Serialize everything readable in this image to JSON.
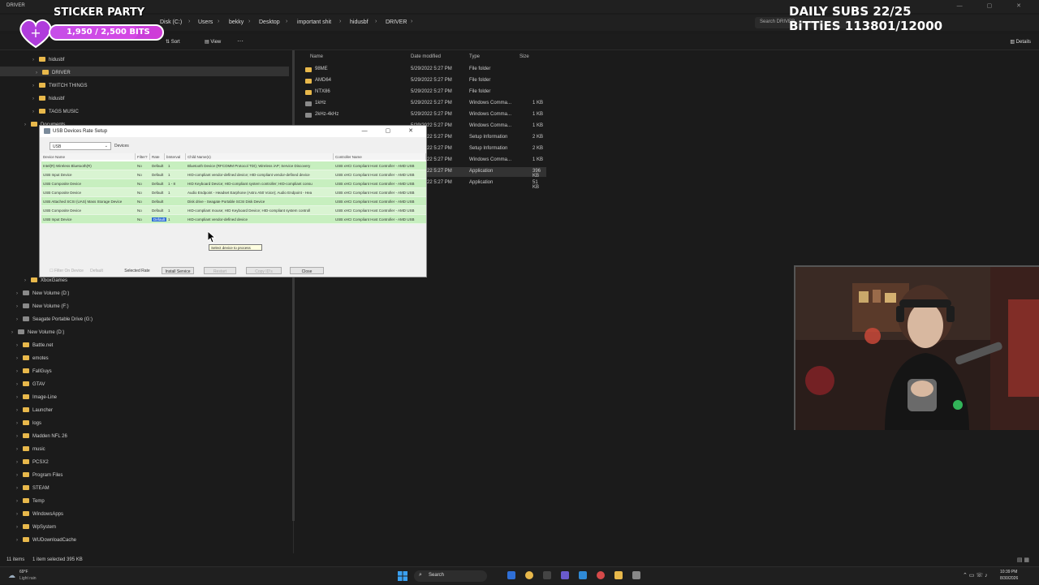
{
  "window": {
    "title": "DRIVER",
    "controls": "—  ▢  ✕"
  },
  "address": {
    "crumbs": [
      "Disk (C:)",
      "Users",
      "bekky",
      "Desktop",
      "important shit",
      "hidusbf",
      "DRIVER"
    ],
    "search_placeholder": "Search DRIVER"
  },
  "toolbar": {
    "sort_label": "Sort",
    "view_label": "View",
    "more_label": "···",
    "details_label": "Details"
  },
  "nav": {
    "items": [
      {
        "label": "hidusbf",
        "type": "folder"
      },
      {
        "label": "DRIVER",
        "type": "folder"
      },
      {
        "label": "TWITCH THINGS",
        "type": "folder"
      },
      {
        "label": "hidusbf",
        "type": "folder"
      },
      {
        "label": "TAGS MUSIC",
        "type": "folder"
      },
      {
        "label": "Documents",
        "type": "folder"
      },
      {
        "label": "XboxGames",
        "type": "folder"
      },
      {
        "label": "New Volume (D:)",
        "type": "drive"
      },
      {
        "label": "New Volume (F:)",
        "type": "drive"
      },
      {
        "label": "Seagate Portable Drive (G:)",
        "type": "drive"
      },
      {
        "label": "New Volume (D:)",
        "type": "drive"
      },
      {
        "label": "Battle.net",
        "type": "folder"
      },
      {
        "label": "emotes",
        "type": "folder"
      },
      {
        "label": "FallGuys",
        "type": "folder"
      },
      {
        "label": "GTAV",
        "type": "folder"
      },
      {
        "label": "Image-Line",
        "type": "folder"
      },
      {
        "label": "Launcher",
        "type": "folder"
      },
      {
        "label": "logs",
        "type": "folder"
      },
      {
        "label": "Madden NFL 26",
        "type": "folder"
      },
      {
        "label": "music",
        "type": "folder"
      },
      {
        "label": "PCSX2",
        "type": "folder"
      },
      {
        "label": "Program Files",
        "type": "folder"
      },
      {
        "label": "STEAM",
        "type": "folder"
      },
      {
        "label": "Temp",
        "type": "folder"
      },
      {
        "label": "WindowsApps",
        "type": "folder"
      },
      {
        "label": "WpSystem",
        "type": "folder"
      },
      {
        "label": "WUDownloadCache",
        "type": "folder"
      },
      {
        "label": "xbox",
        "type": "folder"
      }
    ]
  },
  "files": {
    "headers": {
      "name": "Name",
      "date": "Date modified",
      "type": "Type",
      "size": "Size"
    },
    "rows": [
      {
        "name": "98ME",
        "date": "5/29/2022 5:27 PM",
        "type": "File folder",
        "size": ""
      },
      {
        "name": "AMD64",
        "date": "5/29/2022 5:27 PM",
        "type": "File folder",
        "size": ""
      },
      {
        "name": "NTX86",
        "date": "5/29/2022 5:27 PM",
        "type": "File folder",
        "size": ""
      },
      {
        "name": "1kHz",
        "date": "5/29/2022 5:27 PM",
        "type": "Windows Comma...",
        "size": "1 KB"
      },
      {
        "name": "2kHz-4kHz",
        "date": "5/29/2022 5:27 PM",
        "type": "Windows Comma...",
        "size": "1 KB"
      },
      {
        "name": "",
        "date": "5/29/2022 5:27 PM",
        "type": "Windows Comma...",
        "size": "1 KB"
      },
      {
        "name": "",
        "date": "5/29/2022 5:27 PM",
        "type": "Setup Information",
        "size": "2 KB"
      },
      {
        "name": "",
        "date": "5/29/2022 5:27 PM",
        "type": "Setup Information",
        "size": "2 KB"
      },
      {
        "name": "",
        "date": "5/29/2022 5:27 PM",
        "type": "Windows Comma...",
        "size": "1 KB"
      },
      {
        "name": "",
        "date": "5/29/2022 5:27 PM",
        "type": "Application",
        "size": "396 KB"
      },
      {
        "name": "",
        "date": "5/29/2022 5:27 PM",
        "type": "Application",
        "size": "51 KB"
      }
    ]
  },
  "overlay": {
    "sticker_title": "STICKER PARTY",
    "sticker_bits": "1,950 / 2,500 BITS",
    "sticker_progress": 0.78,
    "subs_line1": "DAILY SUBS 22/25",
    "subs_line2": "BiTTiES 113801/12000"
  },
  "dialog": {
    "title": "USB Devices Rate Setup",
    "controls": "—  ▢  ✕",
    "device_filter": "USB",
    "devices_label": "Devices",
    "headers": [
      "Device Name",
      "Filter?",
      "Rate",
      "bInterval",
      "Child Name(s)",
      "Controller Name"
    ],
    "rows": [
      [
        "Intel(R) Wireless Bluetooth(R)",
        "No",
        "Default",
        "1",
        "Bluetooth Device (RFCOMM Protocol TDI); Wireless iAP; Service Discovery",
        "USB xHCI Compliant Host Controller - AMD USB"
      ],
      [
        "USB Input Device",
        "No",
        "Default",
        "1",
        "HID-compliant vendor-defined device; HID-compliant vendor-defined device",
        "USB xHCI Compliant Host Controller - AMD USB"
      ],
      [
        "USB Composite Device",
        "No",
        "Default",
        "1 - 8",
        "HID Keyboard Device; HID-compliant system controller; HID-compliant consu",
        "USB xHCI Compliant Host Controller - AMD USB"
      ],
      [
        "USB Composite Device",
        "No",
        "Default",
        "1",
        "Audio Endpoint - Headset Earphone (Astro A50 Voice); Audio Endpoint - Hea",
        "USB xHCI Compliant Host Controller - AMD USB"
      ],
      [
        "USB Attached SCSI (UAS) Mass Storage Device",
        "No",
        "Default",
        "",
        "Disk drive - Seagate Portable SCSI Disk Device",
        "USB xHCI Compliant Host Controller - AMD USB"
      ],
      [
        "USB Composite Device",
        "No",
        "Default",
        "1",
        "HID-compliant mouse; HID Keyboard Device; HID-compliant system controll",
        "USB xHCI Compliant Host Controller - AMD USB"
      ],
      [
        "USB Input Device",
        "No",
        "Default",
        "1",
        "HID-compliant vendor-defined device",
        "USB xHCI Compliant Host Controller - AMD USB"
      ]
    ],
    "tooltip": "Select device to process",
    "buttons": {
      "filter_on_device": "Filter On Device",
      "rate_value": "Default",
      "selected_rate": "Selected Rate",
      "install_service": "Install Service",
      "restart": "Restart",
      "copy_ids": "Copy ID's",
      "close": "Close"
    }
  },
  "status": {
    "items": "11 items",
    "selected": "1 item selected  395 KB"
  },
  "taskbar": {
    "weather_temp": "69°F",
    "weather_desc": "Light rain",
    "search_label": "Search",
    "time": "10:39 PM",
    "date": "8/30/2026"
  },
  "colors": {
    "accent": "#2f6fd6",
    "row_green": "#c7efbf",
    "folder": "#e8b84b",
    "sticker_purple": "#b03ddc"
  }
}
